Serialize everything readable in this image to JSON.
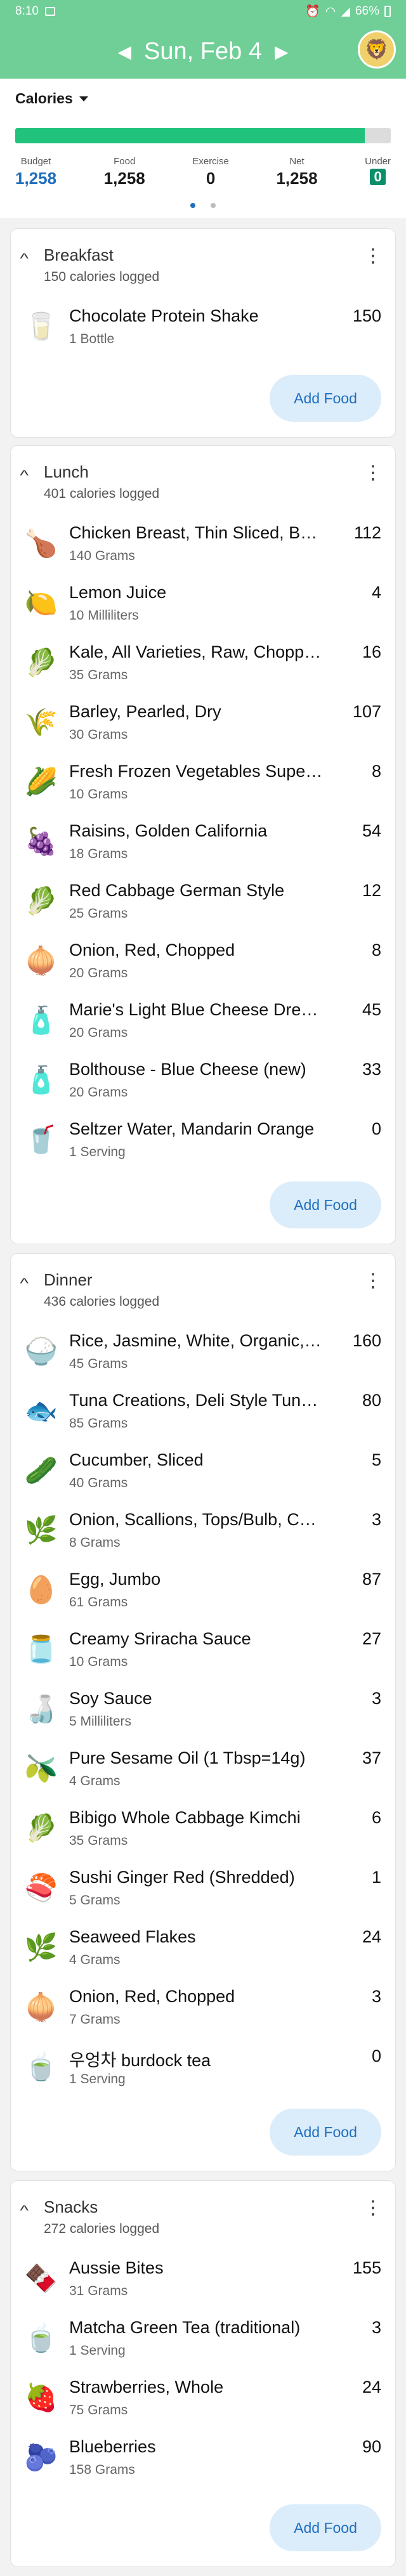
{
  "status": {
    "time": "8:10",
    "battery": "66%"
  },
  "header": {
    "date": "Sun, Feb 4",
    "prev_arrow": "◀",
    "next_arrow": "▶"
  },
  "summary": {
    "metric": "Calories",
    "progress_fraction": 0.93,
    "progress_color": "#20c27c",
    "stats": [
      {
        "label": "Budget",
        "value": "1,258"
      },
      {
        "label": "Food",
        "value": "1,258"
      },
      {
        "label": "Exercise",
        "value": "0"
      },
      {
        "label": "Net",
        "value": "1,258"
      },
      {
        "label": "Under",
        "value": "0"
      }
    ],
    "page_dots": 2,
    "active_dot": 0
  },
  "add_food_label": "Add Food",
  "meals": [
    {
      "title": "Breakfast",
      "subtitle": "150 calories logged",
      "items": [
        {
          "name": "Chocolate Protein Shake",
          "qty": "1 Bottle",
          "cal": "150",
          "icon": "🥛"
        }
      ]
    },
    {
      "title": "Lunch",
      "subtitle": "401 calories logged",
      "items": [
        {
          "name": "Chicken Breast, Thin Sliced, Bon...",
          "qty": "140 Grams",
          "cal": "112",
          "icon": "🍗"
        },
        {
          "name": "Lemon Juice",
          "qty": "10 Milliliters",
          "cal": "4",
          "icon": "🍋"
        },
        {
          "name": "Kale, All Varieties, Raw, Chopped",
          "qty": "35 Grams",
          "cal": "16",
          "icon": "🥬"
        },
        {
          "name": "Barley, Pearled, Dry",
          "qty": "30 Grams",
          "cal": "107",
          "icon": "🌾"
        },
        {
          "name": "Fresh Frozen Vegetables Super Sw...",
          "qty": "10 Grams",
          "cal": "8",
          "icon": "🌽"
        },
        {
          "name": "Raisins, Golden California",
          "qty": "18 Grams",
          "cal": "54",
          "icon": "🍇"
        },
        {
          "name": "Red Cabbage German Style",
          "qty": "25 Grams",
          "cal": "12",
          "icon": "🥬"
        },
        {
          "name": "Onion, Red, Chopped",
          "qty": "20 Grams",
          "cal": "8",
          "icon": "🧅"
        },
        {
          "name": "Marie's Light Blue Cheese Dressin...",
          "qty": "20 Grams",
          "cal": "45",
          "icon": "🧴"
        },
        {
          "name": "Bolthouse - Blue Cheese (new)",
          "qty": "20 Grams",
          "cal": "33",
          "icon": "🧴"
        },
        {
          "name": "Seltzer Water, Mandarin Orange",
          "qty": "1 Serving",
          "cal": "0",
          "icon": "🥤"
        }
      ]
    },
    {
      "title": "Dinner",
      "subtitle": "436 calories logged",
      "items": [
        {
          "name": "Rice, Jasmine, White, Organic, Dry",
          "qty": "45 Grams",
          "cal": "160",
          "icon": "🍚"
        },
        {
          "name": "Tuna Creations, Deli Style Tuna Sa...",
          "qty": "85 Grams",
          "cal": "80",
          "icon": "🐟"
        },
        {
          "name": "Cucumber, Sliced",
          "qty": "40 Grams",
          "cal": "5",
          "icon": "🥒"
        },
        {
          "name": "Onion, Scallions, Tops/Bulb, Chopp...",
          "qty": "8 Grams",
          "cal": "3",
          "icon": "🌿"
        },
        {
          "name": "Egg, Jumbo",
          "qty": "61 Grams",
          "cal": "87",
          "icon": "🥚"
        },
        {
          "name": "Creamy Sriracha Sauce",
          "qty": "10 Grams",
          "cal": "27",
          "icon": "🫙"
        },
        {
          "name": "Soy Sauce",
          "qty": "5 Milliliters",
          "cal": "3",
          "icon": "🍶"
        },
        {
          "name": "Pure Sesame Oil (1 Tbsp=14g)",
          "qty": "4 Grams",
          "cal": "37",
          "icon": "🫒"
        },
        {
          "name": "Bibigo Whole Cabbage Kimchi",
          "qty": "35 Grams",
          "cal": "6",
          "icon": "🥬"
        },
        {
          "name": "Sushi Ginger Red (Shredded)",
          "qty": "5 Grams",
          "cal": "1",
          "icon": "🍣"
        },
        {
          "name": "Seaweed Flakes",
          "qty": "4 Grams",
          "cal": "24",
          "icon": "🌿"
        },
        {
          "name": "Onion, Red, Chopped",
          "qty": "7 Grams",
          "cal": "3",
          "icon": "🧅"
        },
        {
          "name": "우엉차 burdock tea",
          "qty": "1 Serving",
          "cal": "0",
          "icon": "🍵"
        }
      ]
    },
    {
      "title": "Snacks",
      "subtitle": "272 calories logged",
      "items": [
        {
          "name": "Aussie Bites",
          "qty": "31 Grams",
          "cal": "155",
          "icon": "🍫"
        },
        {
          "name": "Matcha Green Tea (traditional)",
          "qty": "1 Serving",
          "cal": "3",
          "icon": "🍵"
        },
        {
          "name": "Strawberries, Whole",
          "qty": "75 Grams",
          "cal": "24",
          "icon": "🍓"
        },
        {
          "name": "Blueberries",
          "qty": "158 Grams",
          "cal": "90",
          "icon": "🫐"
        }
      ]
    }
  ]
}
